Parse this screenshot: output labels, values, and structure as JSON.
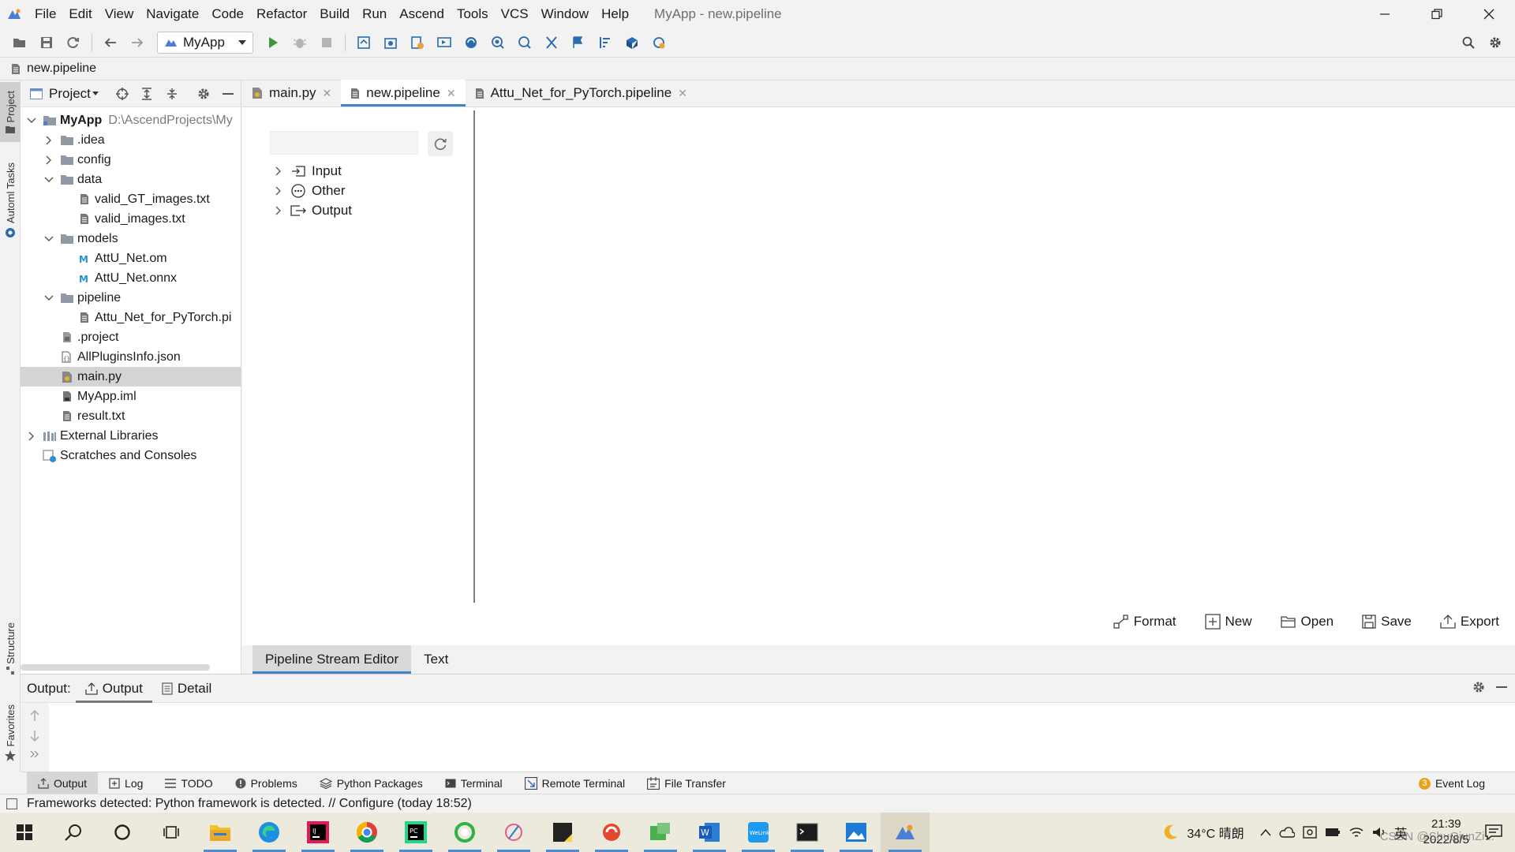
{
  "app": {
    "window_title": "MyApp - new.pipeline"
  },
  "menu": [
    "File",
    "Edit",
    "View",
    "Navigate",
    "Code",
    "Refactor",
    "Build",
    "Run",
    "Ascend",
    "Tools",
    "VCS",
    "Window",
    "Help"
  ],
  "toolbar": {
    "run_config": "MyApp"
  },
  "navbar": {
    "file": "new.pipeline"
  },
  "left_strip": {
    "project": "Project",
    "automl": "Automl Tasks",
    "structure": "Structure",
    "favorites": "Favorites"
  },
  "project_panel": {
    "title": "Project",
    "tree": [
      {
        "label": "MyApp",
        "path": "D:\\AscendProjects\\My",
        "icon": "module-folder-icon",
        "expanded": true
      },
      {
        "label": ".idea",
        "icon": "folder-icon",
        "expanded": false
      },
      {
        "label": "config",
        "icon": "folder-icon",
        "expanded": false
      },
      {
        "label": "data",
        "icon": "folder-icon",
        "expanded": true
      },
      {
        "label": "valid_GT_images.txt",
        "icon": "text-file-icon"
      },
      {
        "label": "valid_images.txt",
        "icon": "text-file-icon"
      },
      {
        "label": "models",
        "icon": "folder-icon",
        "expanded": true
      },
      {
        "label": "AttU_Net.om",
        "icon": "model-file-icon"
      },
      {
        "label": "AttU_Net.onnx",
        "icon": "model-file-icon"
      },
      {
        "label": "pipeline",
        "icon": "folder-icon",
        "expanded": true
      },
      {
        "label": "Attu_Net_for_PyTorch.pi",
        "icon": "text-file-icon"
      },
      {
        "label": ".project",
        "icon": "config-file-icon"
      },
      {
        "label": "AllPluginsInfo.json",
        "icon": "json-file-icon"
      },
      {
        "label": "main.py",
        "icon": "python-file-icon",
        "selected": true
      },
      {
        "label": "MyApp.iml",
        "icon": "iml-file-icon"
      },
      {
        "label": "result.txt",
        "icon": "text-file-icon"
      },
      {
        "label": "External Libraries",
        "icon": "libraries-icon",
        "expanded": false
      },
      {
        "label": "Scratches and Consoles",
        "icon": "scratches-icon"
      }
    ]
  },
  "editor_tabs": [
    {
      "label": "main.py",
      "icon": "python-file-icon",
      "active": false
    },
    {
      "label": "new.pipeline",
      "icon": "text-file-icon",
      "active": true
    },
    {
      "label": "Attu_Net_for_PyTorch.pipeline",
      "icon": "text-file-icon",
      "active": false
    }
  ],
  "palette": {
    "search_value": "",
    "groups": [
      {
        "label": "Input",
        "icon": "input-icon"
      },
      {
        "label": "Other",
        "icon": "other-icon"
      },
      {
        "label": "Output",
        "icon": "output-icon"
      }
    ]
  },
  "editor_actions": [
    "Format",
    "New",
    "Open",
    "Save",
    "Export"
  ],
  "editor_bottom_tabs": [
    {
      "label": "Pipeline Stream Editor",
      "active": true
    },
    {
      "label": "Text",
      "active": false
    }
  ],
  "output_panel": {
    "label": "Output:",
    "tabs": [
      {
        "label": "Output",
        "active": true
      },
      {
        "label": "Detail",
        "active": false
      }
    ]
  },
  "tool_tabs": [
    "Output",
    "Log",
    "TODO",
    "Problems",
    "Python Packages",
    "Terminal",
    "Remote Terminal",
    "File Transfer"
  ],
  "event_log": {
    "label": "Event Log",
    "count": "3"
  },
  "status": {
    "message": "Frameworks detected: Python framework is detected. // Configure (today 18:52)"
  },
  "taskbar": {
    "weather": "34°C  晴朗",
    "ime": "英",
    "time": "21:39",
    "date": "2022/8/5",
    "watermark": "CSDN @ShuQiunZi..."
  },
  "colors": {
    "accent": "#4083c9",
    "run_green": "#3a9a3a",
    "selection": "#d4d4d4"
  }
}
